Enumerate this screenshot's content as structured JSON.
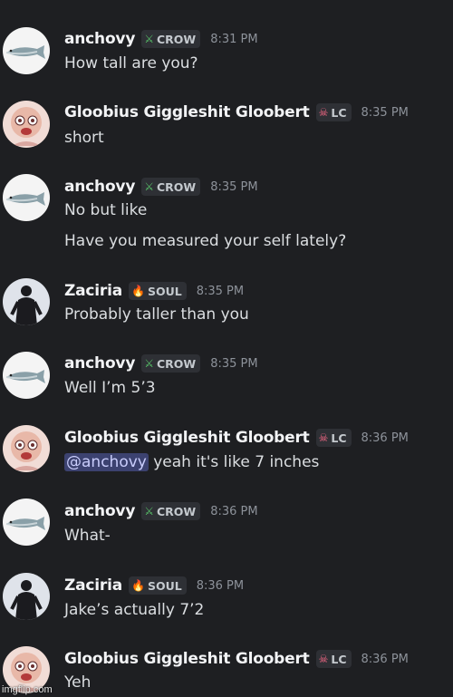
{
  "messages": [
    {
      "author": "anchovy",
      "tag": "CROW",
      "tag_icon": "sword-icon",
      "time": "8:31 PM",
      "avatar": "fish",
      "lines": [
        "How tall are you?"
      ]
    },
    {
      "author": "Gloobius Giggleshit Gloobert",
      "tag": "LC",
      "tag_icon": "skull-icon",
      "time": "8:35 PM",
      "avatar": "cartoon",
      "lines": [
        "short"
      ]
    },
    {
      "author": "anchovy",
      "tag": "CROW",
      "tag_icon": "sword-icon",
      "time": "8:35 PM",
      "avatar": "fish",
      "lines": [
        "No but like",
        "Have you measured your self lately?"
      ]
    },
    {
      "author": "Zaciria",
      "tag": "SOUL",
      "tag_icon": "flame-icon",
      "time": "8:35 PM",
      "avatar": "figure",
      "lines": [
        "Probably taller than you"
      ]
    },
    {
      "author": "anchovy",
      "tag": "CROW",
      "tag_icon": "sword-icon",
      "time": "8:35 PM",
      "avatar": "fish",
      "lines": [
        "Well I’m 5’3"
      ]
    },
    {
      "author": "Gloobius Giggleshit Gloobert",
      "tag": "LC",
      "tag_icon": "skull-icon",
      "time": "8:36 PM",
      "avatar": "cartoon",
      "mention": "@anchovy",
      "lines": [
        " yeah it's like 7 inches"
      ]
    },
    {
      "author": "anchovy",
      "tag": "CROW",
      "tag_icon": "sword-icon",
      "time": "8:36 PM",
      "avatar": "fish",
      "lines": [
        "What-"
      ]
    },
    {
      "author": "Zaciria",
      "tag": "SOUL",
      "tag_icon": "flame-icon",
      "time": "8:36 PM",
      "avatar": "figure",
      "lines": [
        "Jake’s actually 7’2"
      ]
    },
    {
      "author": "Gloobius Giggleshit Gloobert",
      "tag": "LC",
      "tag_icon": "skull-icon",
      "time": "8:36 PM",
      "avatar": "cartoon",
      "lines": [
        "Yeh"
      ]
    }
  ],
  "watermark": "imgflip.com",
  "colors": {
    "background": "#1e1f22",
    "mention_bg": "#3c4270",
    "timestamp": "#8d929a"
  }
}
